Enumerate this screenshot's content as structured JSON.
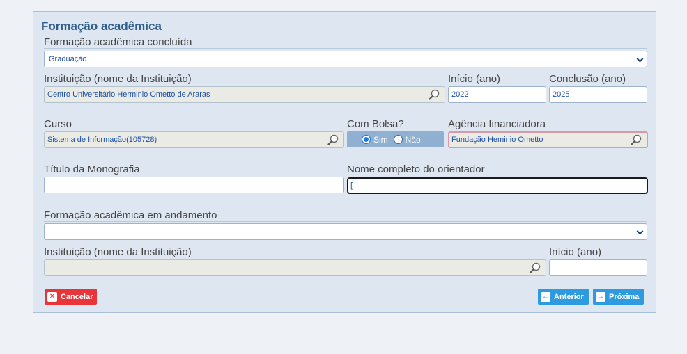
{
  "section_title": "Formação acadêmica",
  "concluded": {
    "label": "Formação acadêmica concluída",
    "selected": "Graduação",
    "institution_label": "Instituição (nome da Instituição)",
    "institution_value": "Centro Universitário Herminio Ometto de Araras",
    "start_label": "Início (ano)",
    "start_value": "2022",
    "end_label": "Conclusão (ano)",
    "end_value": "2025",
    "course_label": "Curso",
    "course_value": "Sistema de Informação(105728)",
    "scholarship_label": "Com Bolsa?",
    "scholarship_yes": "Sim",
    "scholarship_no": "Não",
    "agency_label": "Agência financiadora",
    "agency_value": "Fundação Heminio Ometto",
    "thesis_label": "Título da Monografia",
    "thesis_value": "",
    "advisor_label": "Nome completo do orientador",
    "advisor_value": "["
  },
  "ongoing": {
    "label": "Formação acadêmica em andamento",
    "selected": "",
    "institution_label": "Instituição (nome da Instituição)",
    "institution_value": "",
    "start_label": "Início (ano)",
    "start_value": ""
  },
  "buttons": {
    "cancel": "Cancelar",
    "previous": "Anterior",
    "next": "Próxima"
  },
  "colors": {
    "panel_bg": "#dee7f1",
    "title": "#2e5e8c",
    "cancel": "#e8353a",
    "nav": "#2e9be0"
  }
}
